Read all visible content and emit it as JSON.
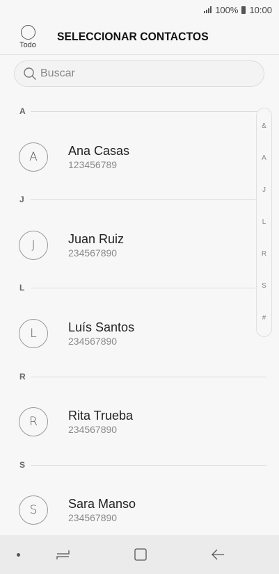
{
  "status": {
    "signal_icon": "signal-icon",
    "battery": "100%",
    "time": "10:00"
  },
  "header": {
    "select_all_label": "Todo",
    "title": "SELECCIONAR CONTACTOS"
  },
  "search": {
    "placeholder": "Buscar"
  },
  "index_letters": [
    "&",
    "A",
    "J",
    "L",
    "R",
    "S",
    "#"
  ],
  "sections": [
    {
      "letter": "A",
      "contacts": [
        {
          "initial": "A",
          "name": "Ana Casas",
          "number": "123456789"
        }
      ]
    },
    {
      "letter": "J",
      "contacts": [
        {
          "initial": "J",
          "name": "Juan Ruiz",
          "number": "234567890"
        }
      ]
    },
    {
      "letter": "L",
      "contacts": [
        {
          "initial": "L",
          "name": "Luís Santos",
          "number": "234567890"
        }
      ]
    },
    {
      "letter": "R",
      "contacts": [
        {
          "initial": "R",
          "name": "Rita Trueba",
          "number": "234567890"
        }
      ]
    },
    {
      "letter": "S",
      "contacts": [
        {
          "initial": "S",
          "name": "Sara Manso",
          "number": "234567890"
        }
      ]
    }
  ],
  "colors": {
    "background": "#f7f7f7",
    "navbar": "#ebebeb",
    "divider": "#dcdcdc"
  }
}
